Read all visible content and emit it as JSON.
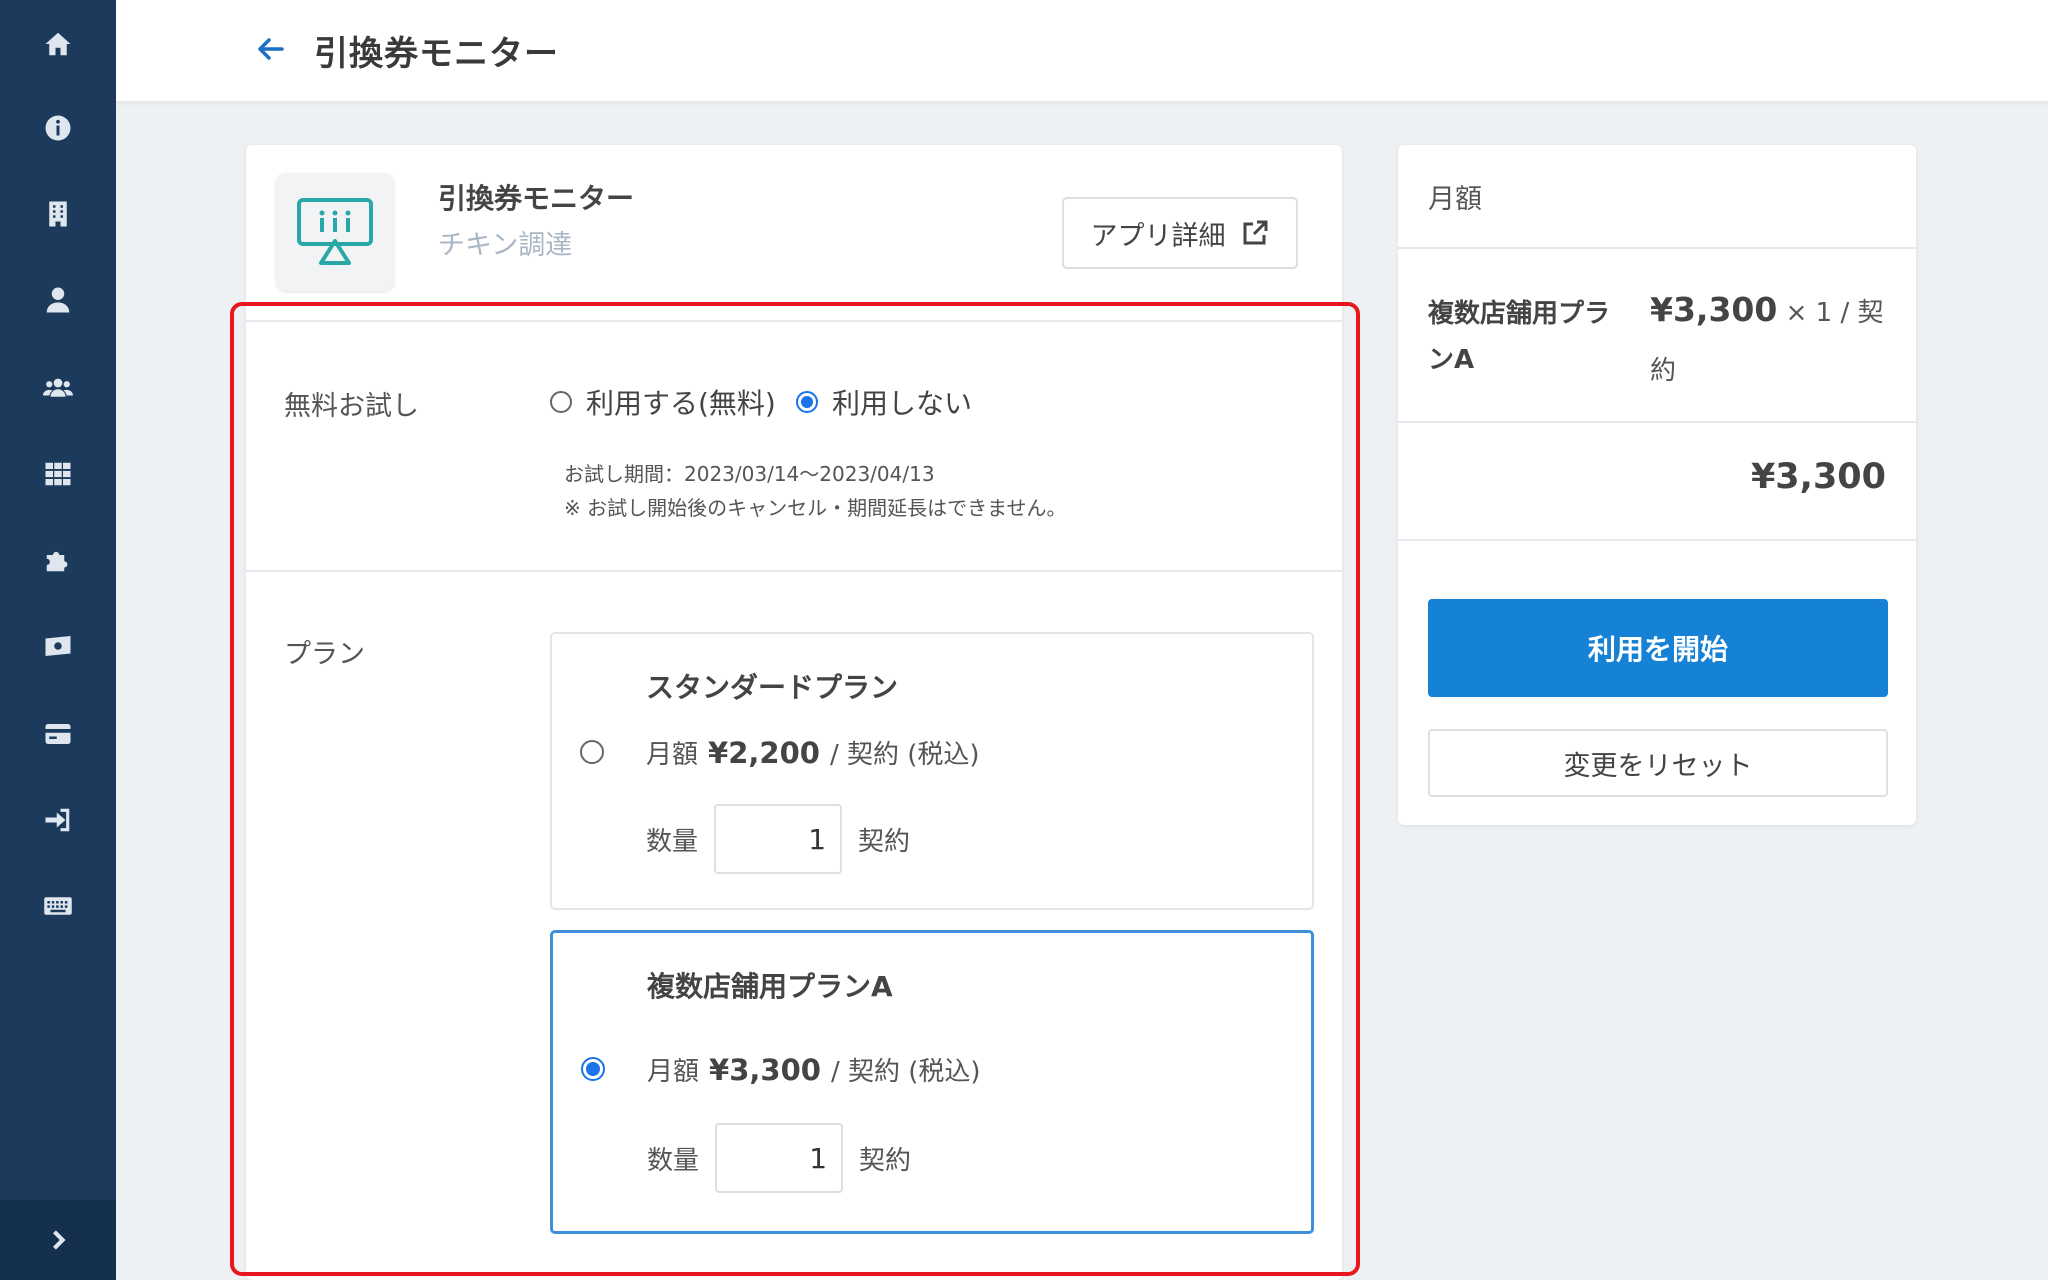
{
  "header": {
    "title": "引換券モニター"
  },
  "sidebar": {
    "items": [
      {
        "icon": "home-icon"
      },
      {
        "icon": "info-icon"
      },
      {
        "icon": "building-icon"
      },
      {
        "icon": "user-icon"
      },
      {
        "icon": "users-icon"
      },
      {
        "icon": "grid-icon"
      },
      {
        "icon": "puzzle-icon"
      },
      {
        "icon": "money-icon"
      },
      {
        "icon": "credit-card-icon"
      },
      {
        "icon": "sign-in-icon"
      },
      {
        "icon": "keyboard-icon"
      }
    ],
    "expand_icon": "chevron-right-icon"
  },
  "app": {
    "name": "引換券モニター",
    "subtitle": "チキン調達",
    "detail_button": "アプリ詳細"
  },
  "trial": {
    "label": "無料お試し",
    "options": [
      {
        "label": "利用する(無料)",
        "checked": false
      },
      {
        "label": "利用しない",
        "checked": true
      }
    ],
    "period": "お試し期間：2023/03/14〜2023/04/13",
    "notice": "※ お試し開始後のキャンセル・期間延長はできません。"
  },
  "plan": {
    "label": "プラン",
    "options": [
      {
        "title": "スタンダードプラン",
        "checked": false,
        "price_prefix": "月額",
        "price": "¥2,200",
        "price_suffix": "/ 契約 (税込)",
        "qty_label": "数量",
        "qty": "1",
        "qty_unit": "契約"
      },
      {
        "title": "複数店舗用プランA",
        "checked": true,
        "price_prefix": "月額",
        "price": "¥3,300",
        "price_suffix": "/ 契約 (税込)",
        "qty_label": "数量",
        "qty": "1",
        "qty_unit": "契約"
      }
    ]
  },
  "summary": {
    "heading": "月額",
    "plan_name": "複数店舗用プランA",
    "unit_price": "¥3,300",
    "calc_suffix": "× 1 / 契約",
    "total": "¥3,300",
    "start_button": "利用を開始",
    "reset_button": "変更をリセット"
  },
  "colors": {
    "sidebar": "#1b3a5c",
    "accent": "#1682d6",
    "highlight": "#e8161e",
    "selected_border": "#3d8fd9"
  }
}
